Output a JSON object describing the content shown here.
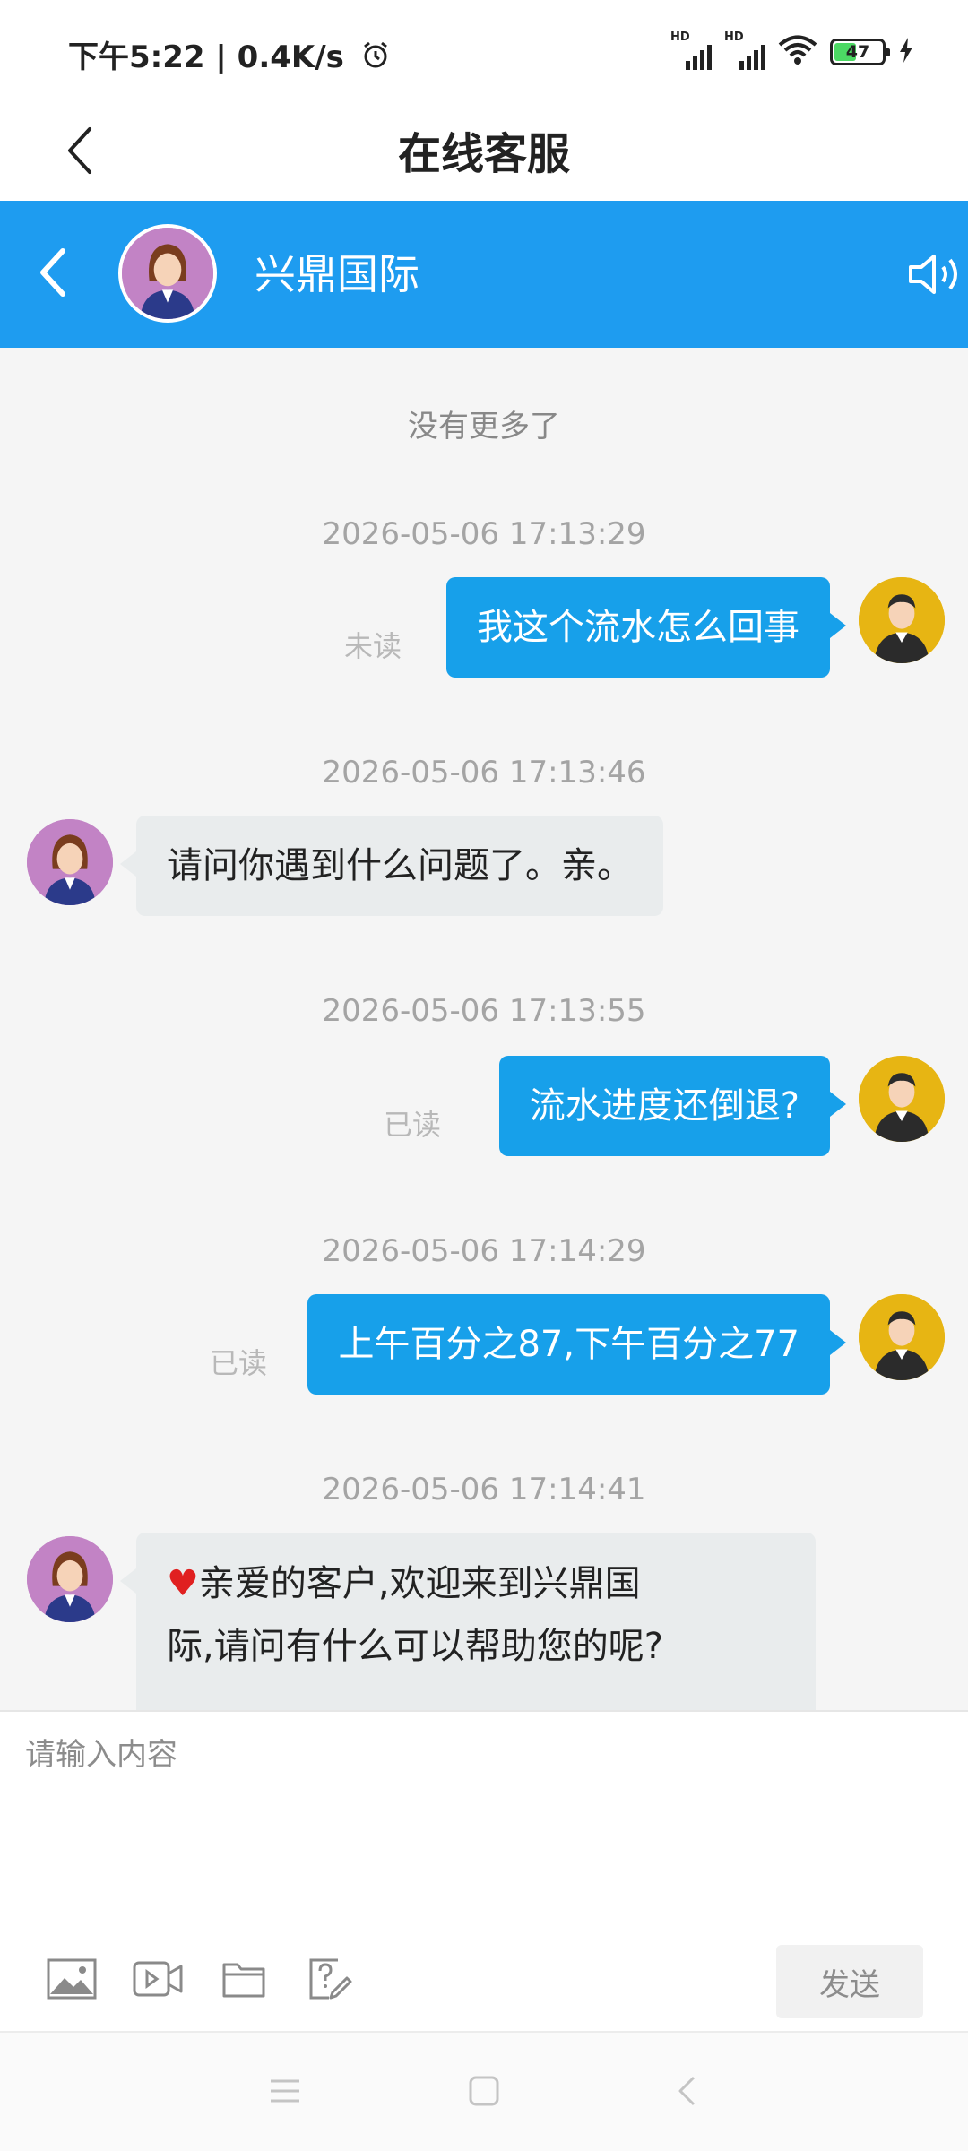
{
  "status_bar": {
    "time": "下午5:22 | 0.4K/s",
    "hd_label": "HD",
    "battery_level": "47",
    "battery_fraction": 0.47
  },
  "nav": {
    "title": "在线客服"
  },
  "chat_header": {
    "name": "兴鼎国际"
  },
  "messages": {
    "no_more": "没有更多了",
    "items": [
      {
        "timestamp": "2026-05-06 17:13:29",
        "direction": "out",
        "text": "我这个流水怎么回事",
        "status": "未读"
      },
      {
        "timestamp": "2026-05-06 17:13:46",
        "direction": "in",
        "text": "请问你遇到什么问题了。亲。"
      },
      {
        "timestamp": "2026-05-06 17:13:55",
        "direction": "out",
        "text": "流水进度还倒退?",
        "status": "已读"
      },
      {
        "timestamp": "2026-05-06 17:14:29",
        "direction": "out",
        "text": "上午百分之87,下午百分之77",
        "status": "已读"
      },
      {
        "timestamp": "2026-05-06 17:14:41",
        "direction": "in",
        "heart": "♥",
        "line1": "亲爱的客户,欢迎来到兴鼎国",
        "line2": "际,请问有什么可以帮助您的呢?"
      }
    ]
  },
  "input": {
    "placeholder": "请输入内容",
    "send_label": "发送"
  },
  "icons": {
    "back": "back-arrow-icon",
    "speaker": "speaker-icon",
    "image": "image-icon",
    "video": "video-icon",
    "folder": "folder-icon",
    "faq": "question-edit-icon",
    "alarm": "alarm-clock-icon",
    "wifi": "wifi-icon",
    "signal": "signal-icon",
    "charging": "charging-bolt-icon"
  },
  "colors": {
    "header_blue": "#1e9cf0",
    "outgoing_bubble": "#17a0ea",
    "incoming_bubble": "#e9eced",
    "agent_avatar_bg": "#c283c5",
    "user_avatar_bg": "#e7b513",
    "battery_green": "#4cd964"
  }
}
